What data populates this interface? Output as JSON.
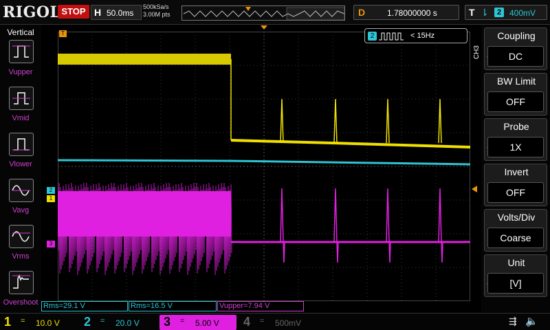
{
  "header": {
    "brand": "RIGOL",
    "run_state": "STOP",
    "horizontal_label": "H",
    "timebase": "50.0ms",
    "sample_rate": "500kSa/s",
    "memory_depth": "3.00M pts",
    "delay_label": "D",
    "delay_value": "1.78000000 s",
    "trigger_label": "T",
    "trigger_source": "2",
    "trigger_level": "400mV"
  },
  "measure_panel": {
    "title": "Vertical",
    "items": [
      {
        "label": "Vupper"
      },
      {
        "label": "Vmid"
      },
      {
        "label": "Vlower"
      },
      {
        "label": "Vavg"
      },
      {
        "label": "Vrms"
      },
      {
        "label": "Overshoot"
      }
    ]
  },
  "trigger_popup": {
    "channel": "2",
    "text": "< 15Hz"
  },
  "markers": {
    "trigger_pos": "T",
    "ch2": "2",
    "ch1": "1",
    "ch3": "3"
  },
  "menu": {
    "channel_tag": "CH3",
    "items": [
      {
        "label": "Coupling",
        "value": "DC"
      },
      {
        "label": "BW Limit",
        "value": "OFF"
      },
      {
        "label": "Probe",
        "value": "1X"
      },
      {
        "label": "Invert",
        "value": "OFF"
      },
      {
        "label": "Volts/Div",
        "value": "Coarse"
      },
      {
        "label": "Unit",
        "value": "[V]"
      }
    ]
  },
  "measurements": [
    {
      "text": "Rms=29.1 V"
    },
    {
      "text": "Rms=16.5 V"
    },
    {
      "text": "Vupper=7.94 V"
    }
  ],
  "channels": [
    {
      "num": "1",
      "coupling": "=",
      "scale": "10.0 V",
      "color": "#f0e000"
    },
    {
      "num": "2",
      "coupling": "=",
      "scale": "20.0 V",
      "color": "#2ec5d4"
    },
    {
      "num": "3",
      "coupling": "=",
      "scale": "5.00 V",
      "color": "#e020e0"
    },
    {
      "num": "4",
      "coupling": "=",
      "scale": "500mV",
      "color": "#555555"
    }
  ],
  "colors": {
    "ch1": "#f0e000",
    "ch2": "#2ec5d4",
    "ch3": "#e020e0",
    "accent": "#e8940a"
  }
}
